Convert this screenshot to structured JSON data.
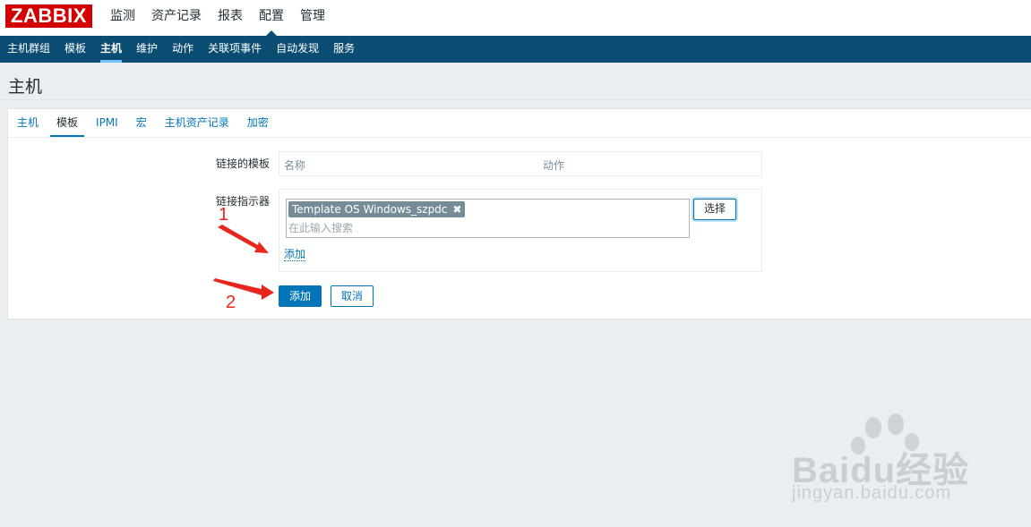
{
  "brand": {
    "logo_text": "ZABBIX",
    "color": "#d40000"
  },
  "main_menu": [
    {
      "label": "监测",
      "active": false
    },
    {
      "label": "资产记录",
      "active": false
    },
    {
      "label": "报表",
      "active": false
    },
    {
      "label": "配置",
      "active": true
    },
    {
      "label": "管理",
      "active": false
    }
  ],
  "sub_menu": [
    {
      "label": "主机群组",
      "active": false
    },
    {
      "label": "模板",
      "active": false
    },
    {
      "label": "主机",
      "active": true
    },
    {
      "label": "维护",
      "active": false
    },
    {
      "label": "动作",
      "active": false
    },
    {
      "label": "关联项事件",
      "active": false
    },
    {
      "label": "自动发现",
      "active": false
    },
    {
      "label": "服务",
      "active": false
    }
  ],
  "page": {
    "title": "主机"
  },
  "tabs": [
    {
      "label": "主机",
      "active": false
    },
    {
      "label": "模板",
      "active": true
    },
    {
      "label": "IPMI",
      "active": false
    },
    {
      "label": "宏",
      "active": false
    },
    {
      "label": "主机资产记录",
      "active": false
    },
    {
      "label": "加密",
      "active": false
    }
  ],
  "form": {
    "linked_templates_label": "链接的模板",
    "linked_table": {
      "col_name": "名称",
      "col_action": "动作"
    },
    "link_new_label": "链接指示器",
    "selected_template": "Template OS Windows_szpdc",
    "chip_remove": "✖",
    "search_placeholder": "在此输入搜索",
    "select_button": "选择",
    "add_link": "添加",
    "submit_button": "添加",
    "cancel_button": "取消"
  },
  "annotations": {
    "step1": "1",
    "step2": "2"
  },
  "watermark": {
    "text": "Baidu经验",
    "sub": "jingyan.baidu.com"
  },
  "colors": {
    "nav_bg": "#0b4d72",
    "accent": "#0275b8",
    "annotation": "#e8261c"
  }
}
